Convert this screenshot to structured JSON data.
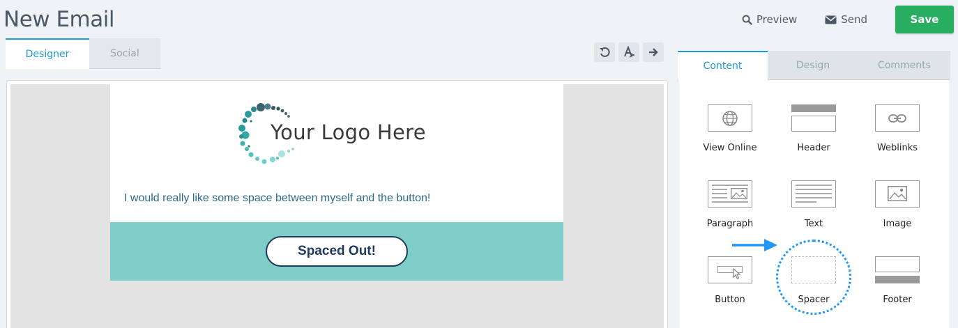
{
  "page": {
    "title": "New Email"
  },
  "top_actions": {
    "preview_label": "Preview",
    "send_label": "Send",
    "save_label": "Save"
  },
  "editor_tabs": [
    {
      "label": "Designer",
      "active": true
    },
    {
      "label": "Social",
      "active": false
    }
  ],
  "toolbar": {
    "icons": [
      "undo-icon",
      "text-style-icon",
      "redo-icon"
    ]
  },
  "email": {
    "logo_text": "Your Logo Here",
    "body_text": "I would really like some space between myself and the button!",
    "button_label": "Spaced Out!",
    "band_color": "#7ecdc9",
    "text_color": "#2c6a8c"
  },
  "side_tabs": [
    {
      "label": "Content",
      "active": true
    },
    {
      "label": "Design",
      "active": false
    },
    {
      "label": "Comments",
      "active": false
    }
  ],
  "content_blocks": [
    {
      "label": "View Online",
      "icon": "globe-icon"
    },
    {
      "label": "Header",
      "icon": "header-block-icon"
    },
    {
      "label": "Weblinks",
      "icon": "link-icon"
    },
    {
      "label": "Paragraph",
      "icon": "paragraph-block-icon"
    },
    {
      "label": "Text",
      "icon": "text-block-icon"
    },
    {
      "label": "Image",
      "icon": "image-block-icon"
    },
    {
      "label": "Button",
      "icon": "button-block-icon"
    },
    {
      "label": "Spacer",
      "icon": "spacer-block-icon",
      "highlighted": true
    },
    {
      "label": "Footer",
      "icon": "footer-block-icon"
    }
  ],
  "colors": {
    "accent": "#1f9ad6",
    "save": "#27ae60",
    "highlight": "#2196f3"
  }
}
